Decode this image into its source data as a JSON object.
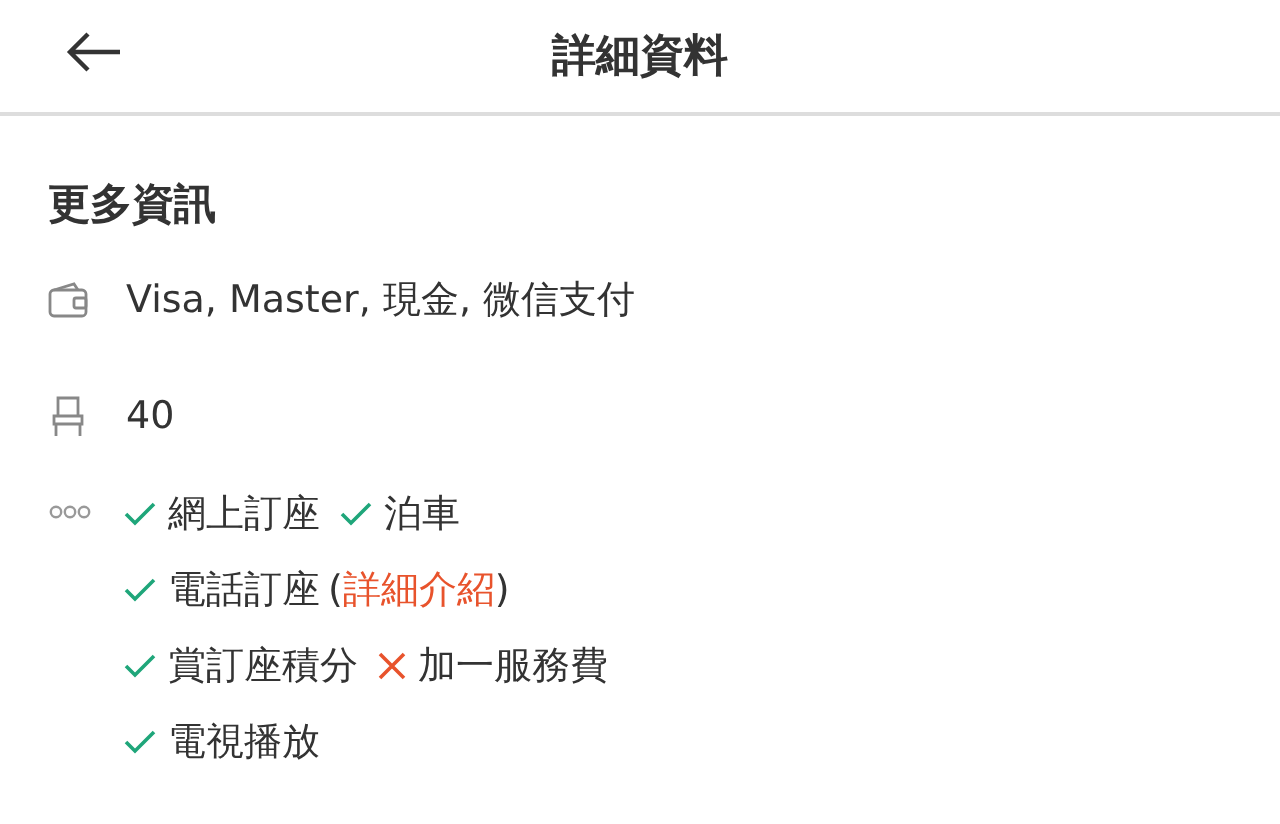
{
  "header": {
    "title": "詳細資料"
  },
  "section": {
    "title": "更多資訊"
  },
  "payment": "Visa, Master, 現金, 微信支付",
  "seats": "40",
  "feature_lines": [
    [
      {
        "label": "網上訂座",
        "available": true
      },
      {
        "label": "泊車",
        "available": true
      }
    ],
    [
      {
        "label": "電話訂座",
        "available": true,
        "note_open": "(",
        "link": "詳細介紹",
        "note_close": ")"
      }
    ],
    [
      {
        "label": "賞訂座積分",
        "available": true
      },
      {
        "label": "加一服務費",
        "available": false
      }
    ],
    [
      {
        "label": "電視播放",
        "available": true
      }
    ]
  ]
}
